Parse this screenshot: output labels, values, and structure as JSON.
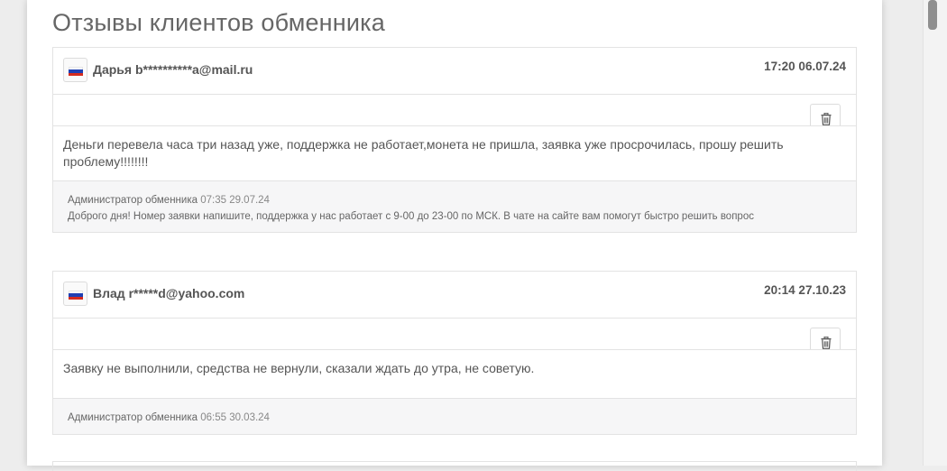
{
  "page": {
    "title": "Отзывы клиентов обменника"
  },
  "flag_colors": {
    "white": "#ffffff",
    "blue": "#1f3fb3",
    "red": "#d52b1e"
  },
  "reviews": [
    {
      "flag": "russia-flag",
      "author": "Дарья b**********a@mail.ru",
      "date": "17:20 06.07.24",
      "text": "Деньги перевела часа три назад уже, поддержка не работает,монета не пришла, заявка уже просрочилась, прошу решить проблему!!!!!!!!",
      "admin": {
        "label": "Администратор обменника",
        "datetime": "07:35 29.07.24",
        "reply": "Доброго дня! Номер заявки напишите, поддержка у нас работает с 9-00 до 23-00 по МСК. В чате на сайте вам помогут быстро решить вопрос"
      }
    },
    {
      "flag": "russia-flag",
      "author": "Влад r*****d@yahoo.com",
      "date": "20:14 27.10.23",
      "text": "Заявку не выполнили, средства не вернули, сказали ждать до утра, не советую.",
      "admin": {
        "label": "Администратор обменника",
        "datetime": "06:55 30.03.24",
        "reply": ""
      }
    }
  ]
}
